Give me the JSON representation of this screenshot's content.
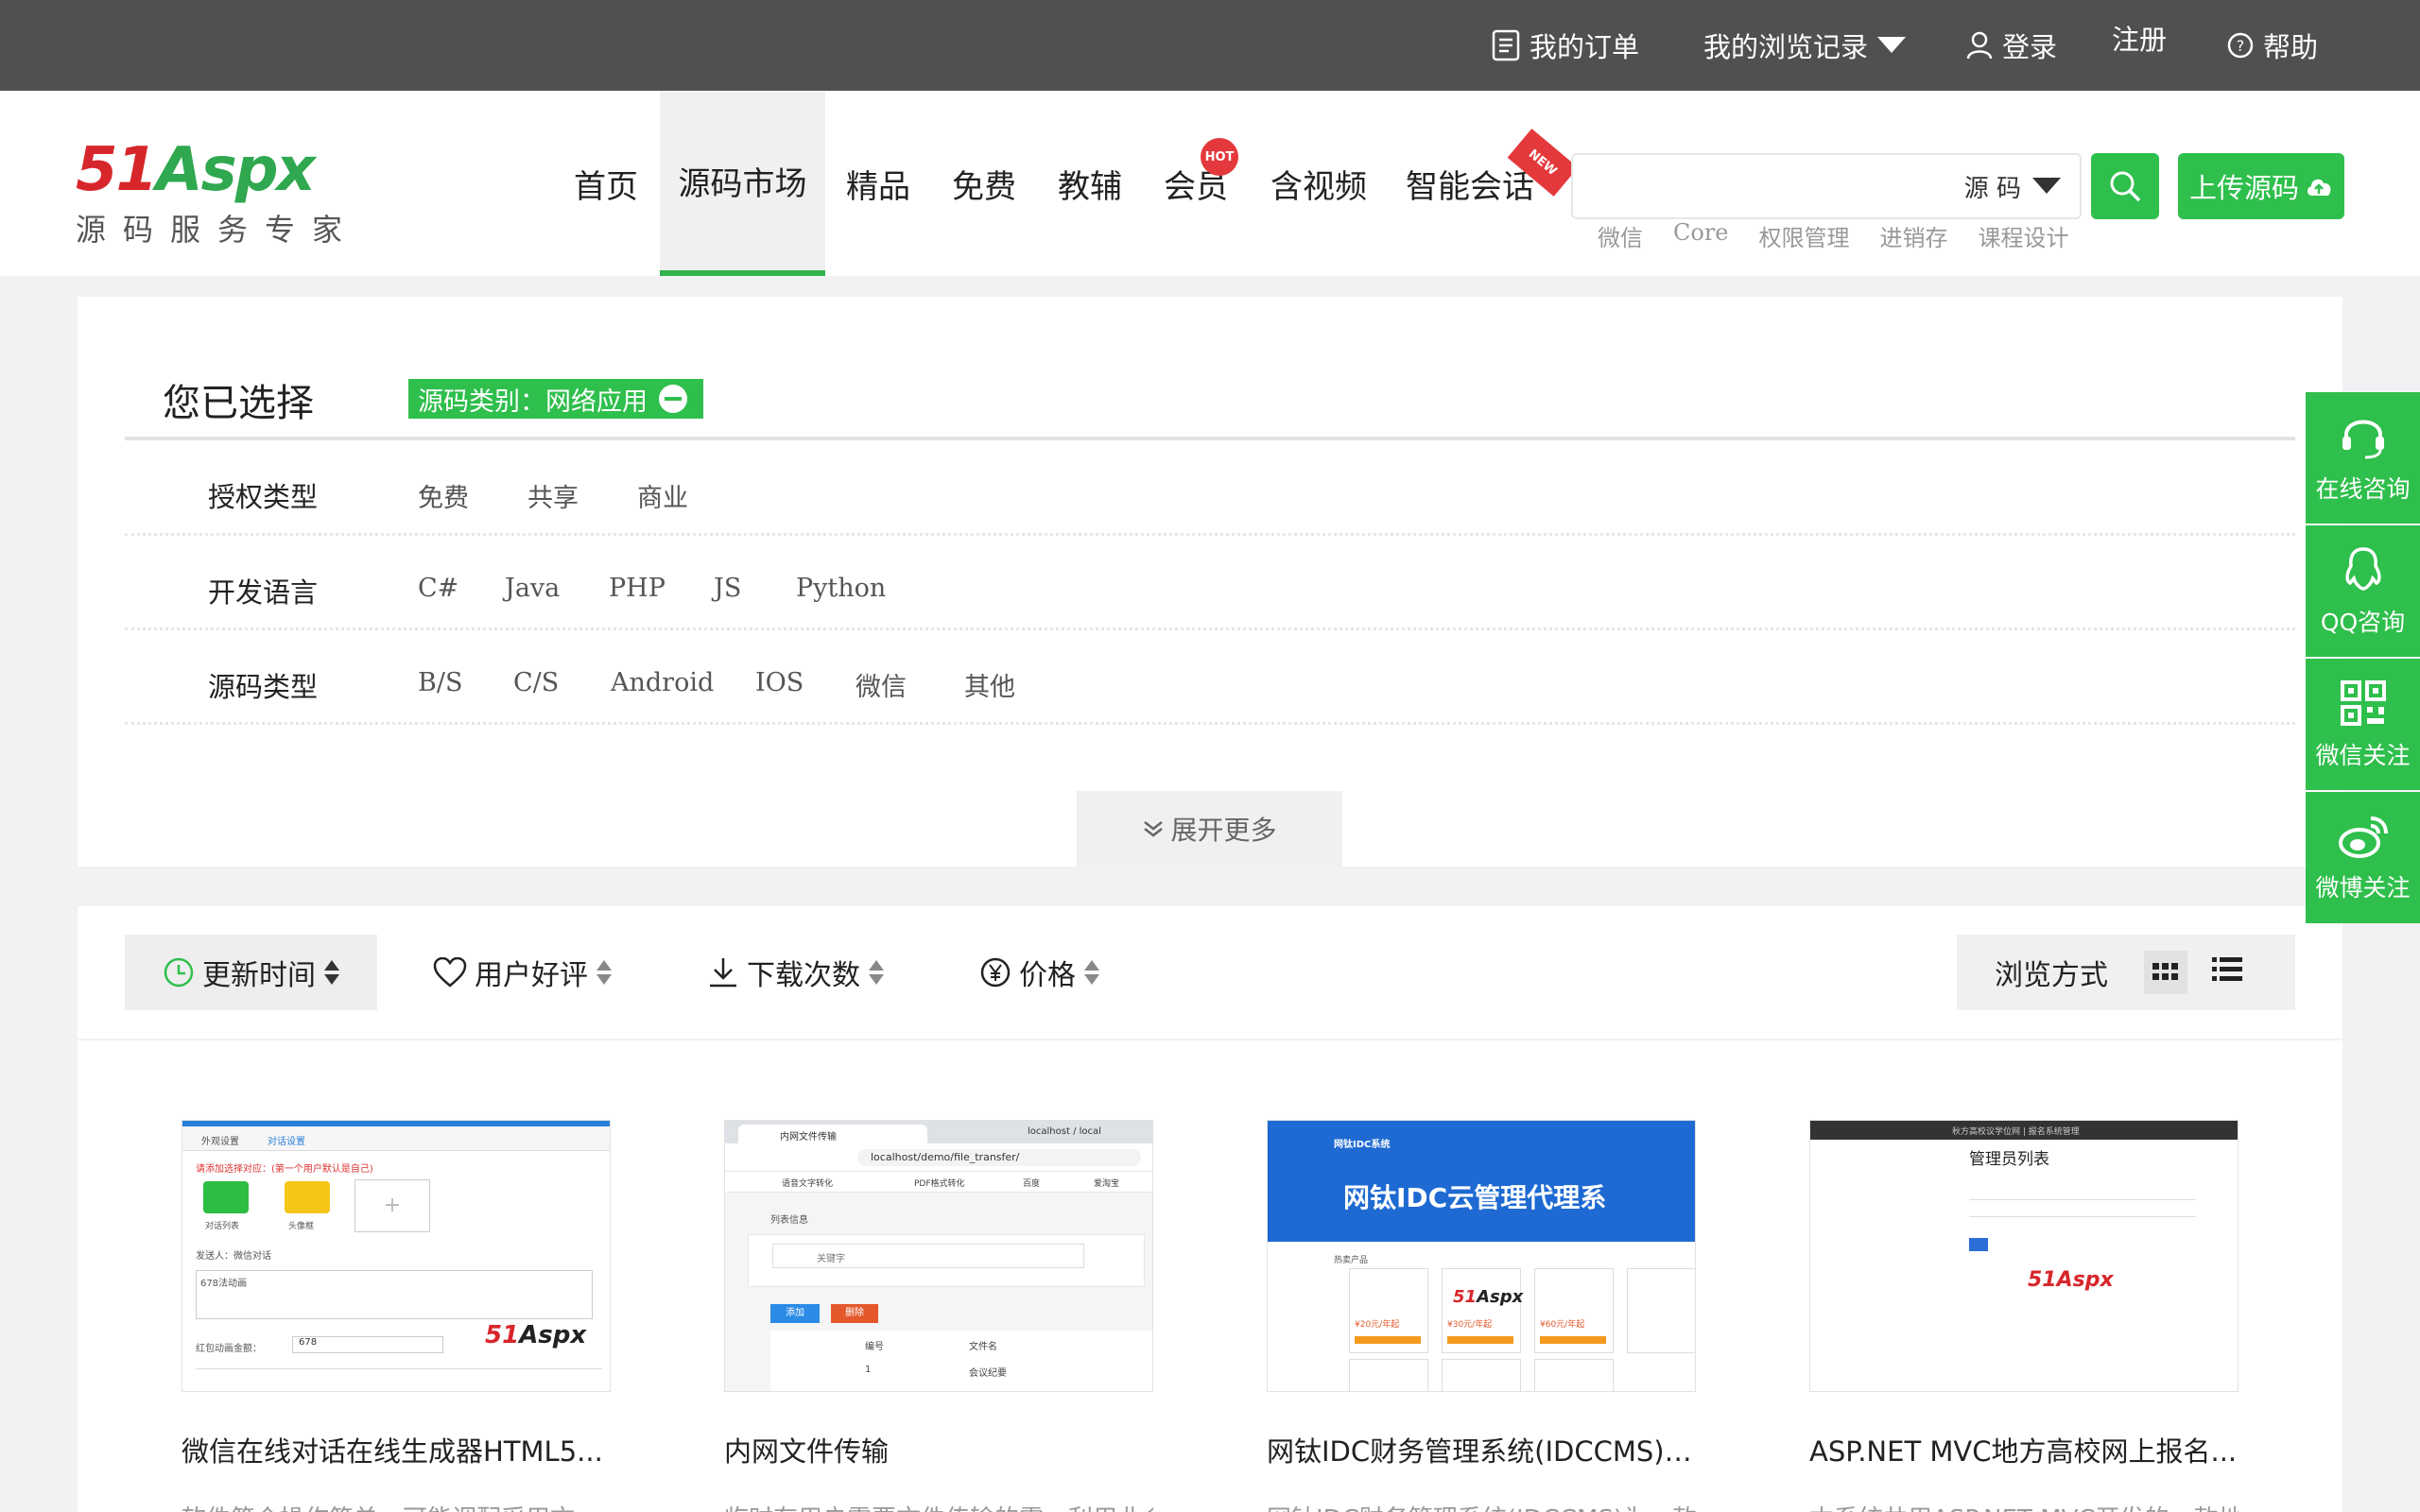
{
  "topbar": {
    "orders": "我的订单",
    "history": "我的浏览记录",
    "login": "登录",
    "register": "注册",
    "help": "帮助"
  },
  "logo": {
    "main_a": "51",
    "main_b": "Aspx",
    "sub": "源码服务专家"
  },
  "nav": {
    "items": [
      "首页",
      "源码市场",
      "精品",
      "免费",
      "教辅",
      "会员",
      "含视频",
      "智能会话"
    ],
    "active": "源码市场",
    "hot_badge": "HOT",
    "new_badge": "NEW"
  },
  "search": {
    "value": "",
    "scope": "源 码",
    "hotwords": [
      "微信",
      "Core",
      "权限管理",
      "进销存",
      "课程设计"
    ],
    "upload_label": "上传源码"
  },
  "filters": {
    "selected_title": "您已选择",
    "selected_tag": "源码类别：网络应用",
    "rows": [
      {
        "label": "授权类型",
        "options": [
          "免费",
          "共享",
          "商业"
        ]
      },
      {
        "label": "开发语言",
        "options": [
          "C#",
          "Java",
          "PHP",
          "JS",
          "Python"
        ]
      },
      {
        "label": "源码类型",
        "options": [
          "B/S",
          "C/S",
          "Android",
          "IOS",
          "微信",
          "其他"
        ]
      }
    ],
    "expand_label": "展开更多"
  },
  "sort": {
    "items": [
      "更新时间",
      "用户好评",
      "下载次数",
      "价格"
    ],
    "active": "更新时间",
    "view_label": "浏览方式"
  },
  "float": [
    "在线咨询",
    "QQ咨询",
    "微信关注",
    "微博关注"
  ],
  "products": [
    {
      "title": "微信在线对话在线生成器HTML5...",
      "desc": "软件简介操作简单，可能调配采用文"
    },
    {
      "title": "内网文件传输",
      "desc": "临时有用户需要文件传输的需，利用业余时"
    },
    {
      "title": "网钛IDC财务管理系统(IDCCMS) ...",
      "desc": "网钛IDC财务管理系统(IDCCMS)为一款"
    },
    {
      "title": "ASP.NET MVC地方高校网上报名...",
      "desc": "本系统共用ASP.NET MVC开发的一款地方高校"
    }
  ],
  "thumbs": {
    "p1": {
      "tab_a": "外观设置",
      "tab_b": "对话设置",
      "line1": "请添加选择对应：(第一个用户默认是自己)",
      "plus": "+",
      "label_a": "对话列表",
      "label_b": "头像框",
      "sender": "发送人：微信对话",
      "text": "678法动画",
      "field": "红包动画金额：",
      "amount": "678"
    },
    "p2": {
      "tab": "内网文件传输",
      "url": "localhost/demo/file_transfer/",
      "b1": "语音文字转化",
      "b2": "PDF格式转化",
      "b3": "百度",
      "b4": "爱淘宝",
      "section": "列表信息",
      "keyword": "关键字",
      "add": "添加",
      "del": "删除",
      "col1": "编号",
      "col2": "文件名",
      "row_id": "1",
      "row_name": "会议纪要",
      "tab2": "localhost / local"
    },
    "p3": {
      "brand": "网钛IDC系统",
      "headline": "网钛IDC云管理代理系",
      "products": "热卖产品",
      "p1": "¥20元/年起",
      "p2": "¥30元/年起",
      "p3": "¥60元/年起"
    },
    "p4": {
      "title": "管理员列表",
      "top": "秋方高校议学位网 | 报名系统管理",
      "watermark": "51Aspx"
    }
  }
}
